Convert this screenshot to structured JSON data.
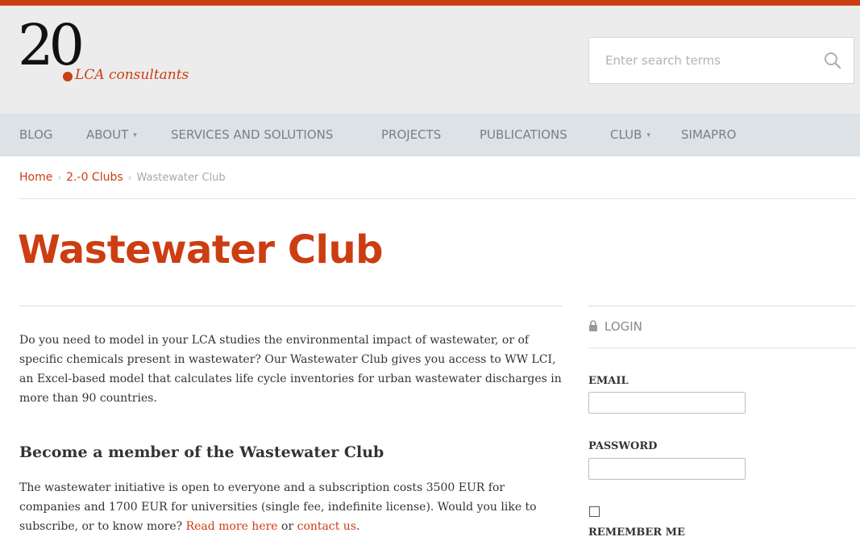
{
  "logo": {
    "mark": "20",
    "tagline": "LCA consultants"
  },
  "search": {
    "placeholder": "Enter search terms"
  },
  "nav": {
    "items": [
      {
        "label": "BLOG"
      },
      {
        "label": "ABOUT",
        "dropdown": true
      },
      {
        "label": "SERVICES AND SOLUTIONS"
      },
      {
        "label": "PROJECTS"
      },
      {
        "label": "PUBLICATIONS"
      },
      {
        "label": "CLUB",
        "dropdown": true
      },
      {
        "label": "SIMAPRO"
      }
    ],
    "caret": "▾"
  },
  "breadcrumb": {
    "home": "Home",
    "clubs": "2.-0 Clubs",
    "current": "Wastewater Club",
    "separator": "›"
  },
  "page": {
    "title": "Wastewater Club",
    "intro": "Do you need to model in your LCA studies the environmental impact of wastewater, or of specific chemicals present in wastewater? Our Wastewater Club gives you access to WW LCI, an Excel-based model that calculates life cycle inventories for urban wastewater discharges in more than 90 countries.",
    "member_heading": "Become a member of the Wastewater Club",
    "member_text_before": "The wastewater initiative is open to everyone and a subscription costs 3500 EUR for companies and 1700 EUR for universities (single fee, indefinite license). Would you like to subscribe, or to know more? ",
    "read_more_link": "Read more here",
    "or_text": " or ",
    "contact_link": "contact us",
    "end_punct": "."
  },
  "login": {
    "heading": "LOGIN",
    "email_label": "EMAIL",
    "password_label": "PASSWORD",
    "remember_label": "REMEMBER ME"
  },
  "colors": {
    "accent": "#cc3d12",
    "nav_bg": "#dde2e7",
    "header_bg": "#ececec"
  }
}
